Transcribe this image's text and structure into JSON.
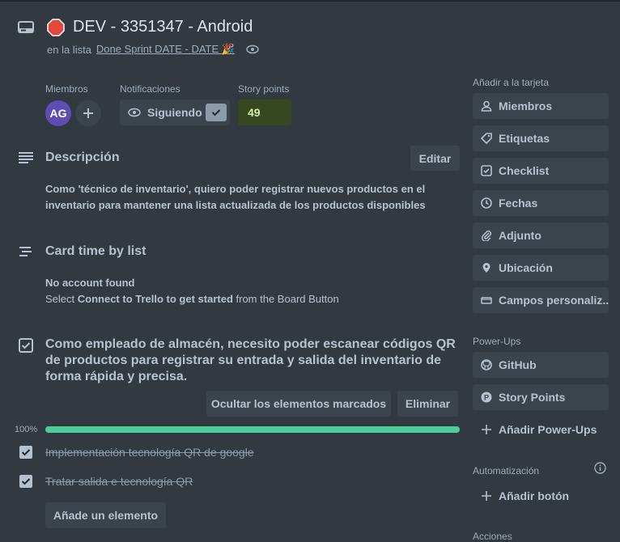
{
  "card": {
    "title": "DEV - 3351347 - Android",
    "list_prefix": "en la lista",
    "list_name": "Done Sprint DATE - DATE 🎉"
  },
  "members": {
    "label": "Miembros",
    "avatar_initials": "AG"
  },
  "notifications": {
    "label": "Notificaciones",
    "button_label": "Siguiendo"
  },
  "story_points": {
    "label": "Story points",
    "value": "49"
  },
  "description": {
    "title": "Descripción",
    "edit_label": "Editar",
    "text": "Como 'técnico de inventario', quiero poder registrar nuevos productos en el inventario para mantener una lista actualizada de los productos disponibles"
  },
  "card_time": {
    "title": "Card time by list",
    "no_account": "No account found",
    "select_prefix": "Select",
    "select_bold": "Connect to Trello to get started",
    "select_suffix": "from the Board Button"
  },
  "checklist": {
    "title": "Como empleado de almacén, necesito poder escanear códigos QR de productos para registrar su entrada y salida del inventario de forma rápida y precisa.",
    "hide_checked_label": "Ocultar los elementos marcados",
    "delete_label": "Eliminar",
    "progress_text": "100%",
    "progress_fraction": 1.0,
    "items": [
      {
        "text": "Implementación tecnología QR de google",
        "checked": true
      },
      {
        "text": "Tratar salida e tecnología QR",
        "checked": true
      }
    ],
    "add_item_label": "Añade un elemento"
  },
  "sidebar": {
    "add_to_card_label": "Añadir a la tarjeta",
    "add_to_card": [
      {
        "label": "Miembros",
        "icon": "person-icon"
      },
      {
        "label": "Etiquetas",
        "icon": "tag-icon"
      },
      {
        "label": "Checklist",
        "icon": "checkbox-icon"
      },
      {
        "label": "Fechas",
        "icon": "clock-icon"
      },
      {
        "label": "Adjunto",
        "icon": "paperclip-icon"
      },
      {
        "label": "Ubicación",
        "icon": "location-pin-icon"
      },
      {
        "label": "Campos personaliz...",
        "icon": "custom-fields-icon"
      }
    ],
    "powerups_label": "Power-Ups",
    "powerups": [
      {
        "label": "GitHub",
        "icon": "github-icon"
      },
      {
        "label": "Story Points",
        "icon": "story-points-icon"
      }
    ],
    "add_powerups_label": "Añadir Power-Ups",
    "automation_label": "Automatización",
    "add_button_label": "Añadir botón",
    "actions_label": "Acciones"
  },
  "colors": {
    "background": "#323940",
    "avatar": "#5e4db2",
    "story_points_bg": "#37471f",
    "progress": "#4bce97",
    "stop_badge": "#e2483d"
  }
}
